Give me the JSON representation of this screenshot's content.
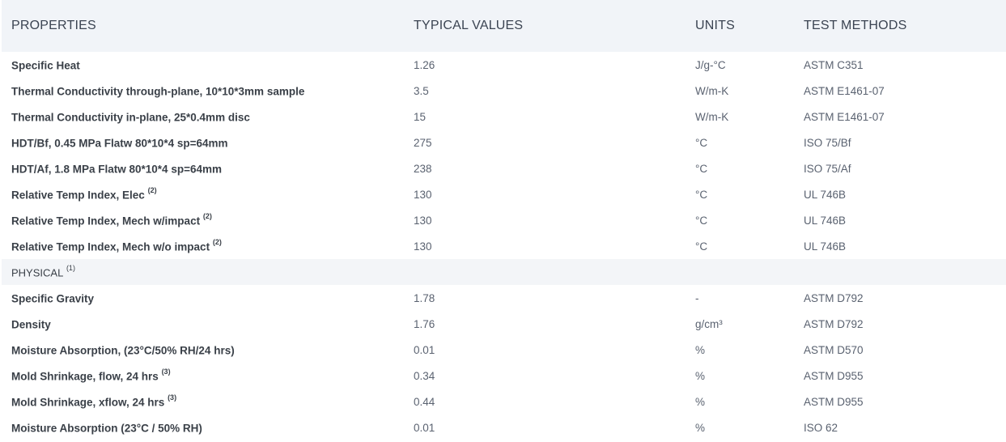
{
  "header": {
    "properties": "PROPERTIES",
    "typical_values": "TYPICAL VALUES",
    "units": "UNITS",
    "test_methods": "TEST METHODS"
  },
  "rows": [
    {
      "property": "Specific Heat",
      "sup": "",
      "value": "1.26",
      "unit": "J/g-°C",
      "method": "ASTM C351"
    },
    {
      "property": "Thermal Conductivity through-plane, 10*10*3mm sample",
      "sup": "",
      "value": "3.5",
      "unit": "W/m-K",
      "method": "ASTM E1461-07"
    },
    {
      "property": "Thermal Conductivity in-plane, 25*0.4mm disc",
      "sup": "",
      "value": "15",
      "unit": "W/m-K",
      "method": "ASTM E1461-07"
    },
    {
      "property": "HDT/Bf, 0.45 MPa Flatw 80*10*4 sp=64mm",
      "sup": "",
      "value": "275",
      "unit": "°C",
      "method": "ISO 75/Bf"
    },
    {
      "property": "HDT/Af, 1.8 MPa Flatw 80*10*4 sp=64mm",
      "sup": "",
      "value": "238",
      "unit": "°C",
      "method": "ISO 75/Af"
    },
    {
      "property": "Relative Temp Index, Elec",
      "sup": "(2)",
      "value": "130",
      "unit": "°C",
      "method": "UL 746B"
    },
    {
      "property": "Relative Temp Index, Mech w/impact",
      "sup": "(2)",
      "value": "130",
      "unit": "°C",
      "method": "UL 746B"
    },
    {
      "property": "Relative Temp Index, Mech w/o impact",
      "sup": "(2)",
      "value": "130",
      "unit": "°C",
      "method": "UL 746B"
    }
  ],
  "section": {
    "label": "PHYSICAL",
    "sup": "(1)"
  },
  "rows2": [
    {
      "property": "Specific Gravity",
      "sup": "",
      "value": "1.78",
      "unit": "-",
      "method": "ASTM D792"
    },
    {
      "property": "Density",
      "sup": "",
      "value": "1.76",
      "unit": "g/cm³",
      "method": "ASTM D792"
    },
    {
      "property": "Moisture Absorption, (23°C/50% RH/24 hrs)",
      "sup": "",
      "value": "0.01",
      "unit": "%",
      "method": "ASTM D570"
    },
    {
      "property": "Mold Shrinkage, flow, 24 hrs",
      "sup": "(3)",
      "value": "0.34",
      "unit": "%",
      "method": "ASTM D955"
    },
    {
      "property": "Mold Shrinkage, xflow, 24 hrs",
      "sup": "(3)",
      "value": "0.44",
      "unit": "%",
      "method": "ASTM D955"
    },
    {
      "property": "Moisture Absorption (23°C / 50% RH)",
      "sup": "",
      "value": "0.01",
      "unit": "%",
      "method": "ISO 62"
    }
  ]
}
